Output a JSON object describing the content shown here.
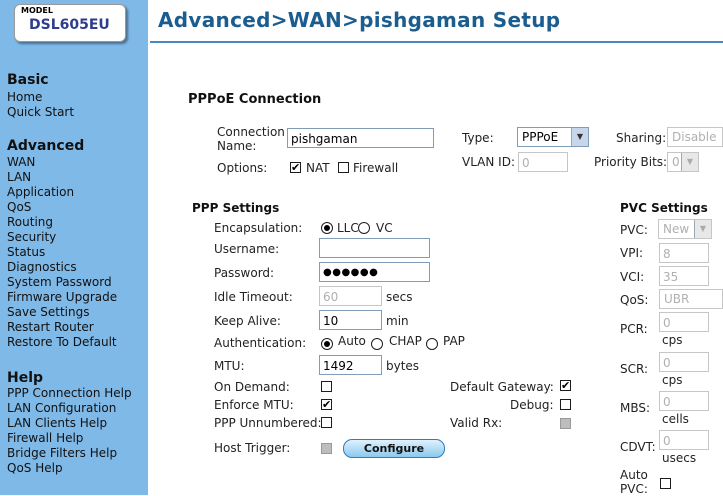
{
  "logo": {
    "model": "MODEL",
    "name": "DSL605EU"
  },
  "page_title": "Advanced>WAN>pishgaman Setup",
  "sidebar": {
    "basic_heading": "Basic",
    "basic_items": [
      "Home",
      "Quick Start"
    ],
    "advanced_heading": "Advanced",
    "advanced_items": [
      "WAN",
      "LAN",
      "Application",
      "QoS",
      "Routing",
      "Security",
      "Status",
      "Diagnostics",
      "System Password",
      "Firmware Upgrade",
      "Save Settings",
      "Restart Router",
      "Restore To Default"
    ],
    "help_heading": "Help",
    "help_items": [
      "PPP Connection Help",
      "LAN Configuration",
      "LAN Clients Help",
      "Firewall Help",
      "Bridge Filters Help",
      "QoS Help"
    ]
  },
  "pppoe": {
    "heading": "PPPoE Connection",
    "connection_name_label_1": "Connection",
    "connection_name_label_2": "Name:",
    "connection_name_value": "pishgaman",
    "options_label": "Options:",
    "nat_label": "NAT",
    "nat_checked": true,
    "firewall_label": "Firewall",
    "firewall_checked": false,
    "type_label": "Type:",
    "type_value": "PPPoE",
    "vlan_id_label": "VLAN ID:",
    "vlan_id_value": "0",
    "sharing_label": "Sharing:",
    "sharing_value": "Disable",
    "priority_bits_label": "Priority Bits:",
    "priority_bits_value": "0"
  },
  "ppp": {
    "heading": "PPP Settings",
    "encapsulation_label": "Encapsulation:",
    "enc_llc": "LLC",
    "enc_vc": "VC",
    "enc_selected": "LLC",
    "username_label": "Username:",
    "username_value": "",
    "password_label": "Password:",
    "password_value": "●●●●●●",
    "idle_timeout_label": "Idle Timeout:",
    "idle_timeout_value": "60",
    "idle_timeout_unit": "secs",
    "keep_alive_label": "Keep Alive:",
    "keep_alive_value": "10",
    "keep_alive_unit": "min",
    "auth_label": "Authentication:",
    "auth_auto": "Auto",
    "auth_chap": "CHAP",
    "auth_pap": "PAP",
    "auth_selected": "Auto",
    "mtu_label": "MTU:",
    "mtu_value": "1492",
    "mtu_unit": "bytes",
    "on_demand_label": "On Demand:",
    "on_demand_checked": false,
    "enforce_mtu_label": "Enforce MTU:",
    "enforce_mtu_checked": true,
    "ppp_unnumbered_label": "PPP Unnumbered:",
    "ppp_unnumbered_checked": false,
    "host_trigger_label": "Host Trigger:",
    "configure_label": "Configure",
    "default_gateway_label": "Default Gateway:",
    "default_gateway_checked": true,
    "debug_label": "Debug:",
    "debug_checked": false,
    "valid_rx_label": "Valid Rx:"
  },
  "pvc": {
    "heading": "PVC Settings",
    "pvc_label": "PVC:",
    "pvc_value": "New",
    "vpi_label": "VPI:",
    "vpi_value": "8",
    "vci_label": "VCI:",
    "vci_value": "35",
    "qos_label": "QoS:",
    "qos_value": "UBR",
    "pcr_label": "PCR:",
    "pcr_value": "0",
    "pcr_unit": "cps",
    "scr_label": "SCR:",
    "scr_value": "0",
    "scr_unit": "cps",
    "mbs_label": "MBS:",
    "mbs_value": "0",
    "mbs_unit": "cells",
    "cdvt_label": "CDVT:",
    "cdvt_value": "0",
    "cdvt_unit": "usecs",
    "auto_pvc_label_1": "Auto",
    "auto_pvc_label_2": "PVC:",
    "auto_pvc_checked": false
  }
}
